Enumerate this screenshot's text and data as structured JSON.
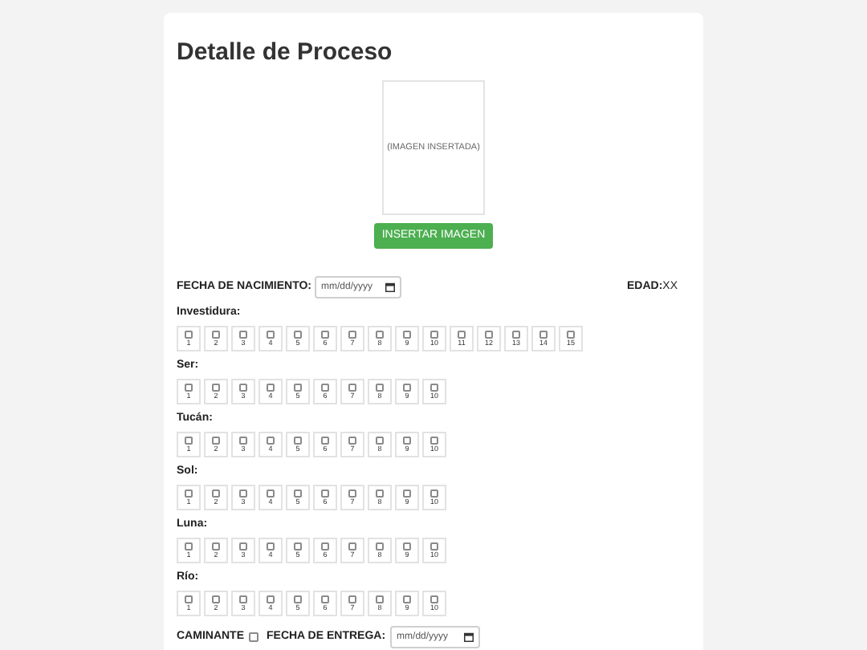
{
  "title": "Detalle de Proceso",
  "image": {
    "caption": "(IMAGEN INSERTADA)"
  },
  "insert_button": "INSERTAR IMAGEN",
  "birth_date": {
    "label": "FECHA DE NACIMIENTO:",
    "placeholder": "mm/dd/yyyy"
  },
  "age": {
    "label": "EDAD:",
    "value": "XX"
  },
  "sections": [
    {
      "label": "Investidura:",
      "items": [
        {
          "label": "1",
          "checked": false
        },
        {
          "label": "2",
          "checked": false
        },
        {
          "label": "3",
          "checked": false
        },
        {
          "label": "4",
          "checked": false
        },
        {
          "label": "5",
          "checked": false
        },
        {
          "label": "6",
          "checked": false
        },
        {
          "label": "7",
          "checked": false
        },
        {
          "label": "8",
          "checked": false
        },
        {
          "label": "9",
          "checked": false
        },
        {
          "label": "10",
          "checked": false
        },
        {
          "label": "11",
          "checked": false
        },
        {
          "label": "12",
          "checked": false
        },
        {
          "label": "13",
          "checked": false
        },
        {
          "label": "14",
          "checked": false
        },
        {
          "label": "15",
          "checked": false
        }
      ]
    },
    {
      "label": "Ser:",
      "items": [
        {
          "label": "1",
          "checked": false
        },
        {
          "label": "2",
          "checked": false
        },
        {
          "label": "3",
          "checked": false
        },
        {
          "label": "4",
          "checked": false
        },
        {
          "label": "5",
          "checked": false
        },
        {
          "label": "6",
          "checked": false
        },
        {
          "label": "7",
          "checked": false
        },
        {
          "label": "8",
          "checked": false
        },
        {
          "label": "9",
          "checked": false
        },
        {
          "label": "10",
          "checked": false
        }
      ]
    },
    {
      "label": "Tucán:",
      "items": [
        {
          "label": "1",
          "checked": false
        },
        {
          "label": "2",
          "checked": false
        },
        {
          "label": "3",
          "checked": false
        },
        {
          "label": "4",
          "checked": false
        },
        {
          "label": "5",
          "checked": false
        },
        {
          "label": "6",
          "checked": false
        },
        {
          "label": "7",
          "checked": false
        },
        {
          "label": "8",
          "checked": false
        },
        {
          "label": "9",
          "checked": false
        },
        {
          "label": "10",
          "checked": false
        }
      ]
    },
    {
      "label": "Sol:",
      "items": [
        {
          "label": "1",
          "checked": false
        },
        {
          "label": "2",
          "checked": false
        },
        {
          "label": "3",
          "checked": false
        },
        {
          "label": "4",
          "checked": false
        },
        {
          "label": "5",
          "checked": false
        },
        {
          "label": "6",
          "checked": false
        },
        {
          "label": "7",
          "checked": false
        },
        {
          "label": "8",
          "checked": false
        },
        {
          "label": "9",
          "checked": false
        },
        {
          "label": "10",
          "checked": false
        }
      ]
    },
    {
      "label": "Luna:",
      "items": [
        {
          "label": "1",
          "checked": false
        },
        {
          "label": "2",
          "checked": false
        },
        {
          "label": "3",
          "checked": false
        },
        {
          "label": "4",
          "checked": false
        },
        {
          "label": "5",
          "checked": false
        },
        {
          "label": "6",
          "checked": false
        },
        {
          "label": "7",
          "checked": false
        },
        {
          "label": "8",
          "checked": false
        },
        {
          "label": "9",
          "checked": false
        },
        {
          "label": "10",
          "checked": false
        }
      ]
    },
    {
      "label": "Río:",
      "items": [
        {
          "label": "1",
          "checked": false
        },
        {
          "label": "2",
          "checked": false
        },
        {
          "label": "3",
          "checked": false
        },
        {
          "label": "4",
          "checked": false
        },
        {
          "label": "5",
          "checked": false
        },
        {
          "label": "6",
          "checked": false
        },
        {
          "label": "7",
          "checked": false
        },
        {
          "label": "8",
          "checked": false
        },
        {
          "label": "9",
          "checked": false
        },
        {
          "label": "10",
          "checked": false
        }
      ]
    }
  ],
  "walker": {
    "label": "CAMINANTE",
    "checked": false
  },
  "delivery_date": {
    "label": "FECHA DE ENTREGA:",
    "placeholder": "mm/dd/yyyy"
  }
}
